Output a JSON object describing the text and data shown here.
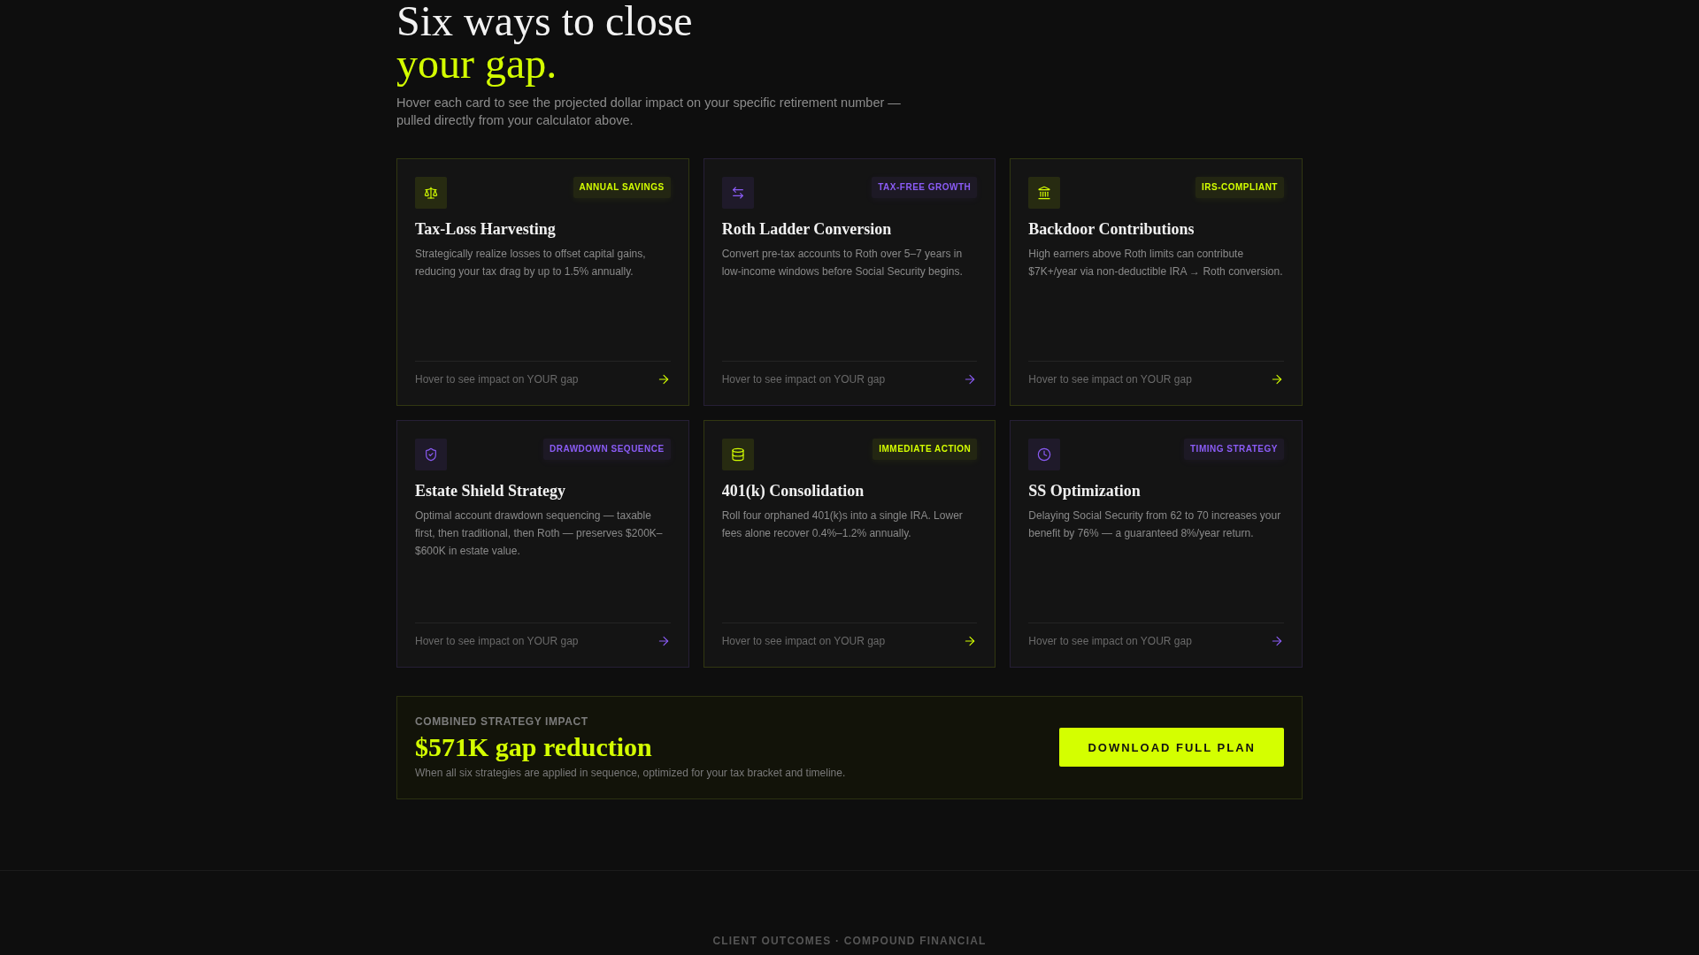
{
  "section": {
    "title": "Six ways to close",
    "title_highlight": "your gap.",
    "subtitle": "Hover each card to see the projected dollar impact on your specific retirement number — pulled directly from your calculator above."
  },
  "cards": [
    {
      "badge": "ANNUAL SAVINGS",
      "title": "Tax-Loss Harvesting",
      "description": "Strategically realize losses to offset capital gains, reducing your tax drag by up to 1.5% annually.",
      "hint": "Hover to see impact on YOUR gap",
      "color": "#d4ff00"
    },
    {
      "badge": "TAX-FREE GROWTH",
      "title": "Roth Ladder Conversion",
      "description": "Convert pre-tax accounts to Roth over 5–7 years in low-income windows before Social Security begins.",
      "hint": "Hover to see impact on YOUR gap",
      "color": "#8b5cf6"
    },
    {
      "badge": "IRS-COMPLIANT",
      "title": "Backdoor Contributions",
      "description": "High earners above Roth limits can contribute $7K+/year via non-deductible IRA → Roth conversion.",
      "hint": "Hover to see impact on YOUR gap",
      "color": "#d4ff00"
    },
    {
      "badge": "DRAWDOWN SEQUENCE",
      "title": "Estate Shield Strategy",
      "description": "Optimal account drawdown sequencing — taxable first, then traditional, then Roth — preserves $200K–$600K in estate value.",
      "hint": "Hover to see impact on YOUR gap",
      "color": "#8b5cf6"
    },
    {
      "badge": "IMMEDIATE ACTION",
      "title": "401(k) Consolidation",
      "description": "Roll four orphaned 401(k)s into a single IRA. Lower fees alone recover 0.4%–1.2% annually.",
      "hint": "Hover to see impact on YOUR gap",
      "color": "#d4ff00"
    },
    {
      "badge": "TIMING STRATEGY",
      "title": "SS Optimization",
      "description": "Delaying Social Security from 62 to 70 increases your benefit by 76% — a guaranteed 8%/year return.",
      "hint": "Hover to see impact on YOUR gap",
      "color": "#8b5cf6"
    }
  ],
  "summary": {
    "label": "COMBINED STRATEGY IMPACT",
    "value": "$571K gap reduction",
    "description": "When all six strategies are applied in sequence, optimized for your tax bracket and timeline.",
    "button": "DOWNLOAD FULL PLAN"
  },
  "footer": {
    "text": "CLIENT OUTCOMES · COMPOUND FINANCIAL"
  }
}
